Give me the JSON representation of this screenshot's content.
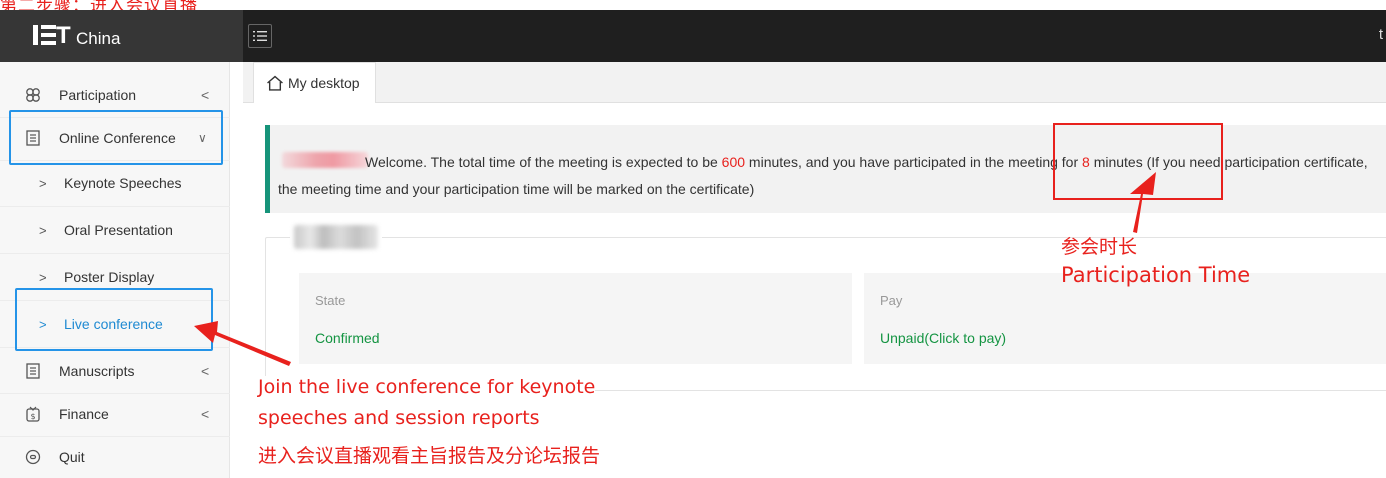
{
  "header": {
    "logo_T": "T",
    "logo_text": "China",
    "user_initial": "t",
    "menu_icon": "list-icon"
  },
  "top_crop_text": "第二步骤：进入会议直播",
  "sidebar": {
    "items": [
      {
        "label": "Participation",
        "icon": "clover-icon",
        "arrow": "<"
      },
      {
        "label": "Online Conference",
        "icon": "document-icon",
        "arrow": "∨"
      },
      {
        "label": "Keynote Speeches",
        "chev": ">"
      },
      {
        "label": "Oral Presentation",
        "chev": ">"
      },
      {
        "label": "Poster Display",
        "chev": ">"
      },
      {
        "label": "Live conference",
        "chev": ">"
      },
      {
        "label": "Manuscripts",
        "icon": "document-icon",
        "arrow": "<"
      },
      {
        "label": "Finance",
        "icon": "finance-icon",
        "arrow": "<"
      },
      {
        "label": "Quit",
        "icon": "power-icon"
      }
    ]
  },
  "tab": {
    "label": "My desktop",
    "icon": "home-icon"
  },
  "welcome": {
    "part1": "Welcome. The total time of the meeting is expected to be ",
    "total_minutes": "600",
    "part2": " minutes, and you have participated in the meeting for ",
    "participated_minutes": "8",
    "part3": " minutes (If you need participation certificate, the meeting time and your participation time will be marked on the certificate)"
  },
  "cards": {
    "state": {
      "title": "State",
      "value": "Confirmed"
    },
    "pay": {
      "title": "Pay",
      "value": "Unpaid(Click to pay)"
    }
  },
  "annotations": {
    "participation_time_cn": "参会时长",
    "participation_time_en": "Participation Time",
    "live_line1": "Join the live conference for keynote",
    "live_line2": "speeches and session reports",
    "live_cn": "进入会议直播观看主旨报告及分论坛报告"
  },
  "colors": {
    "accent_teal": "#16947a",
    "highlight_red": "#e8211d",
    "annotation_blue": "#2594e8",
    "status_green": "#149442",
    "active_link": "#1f8ad2",
    "header_bg": "#1f1f1f"
  }
}
